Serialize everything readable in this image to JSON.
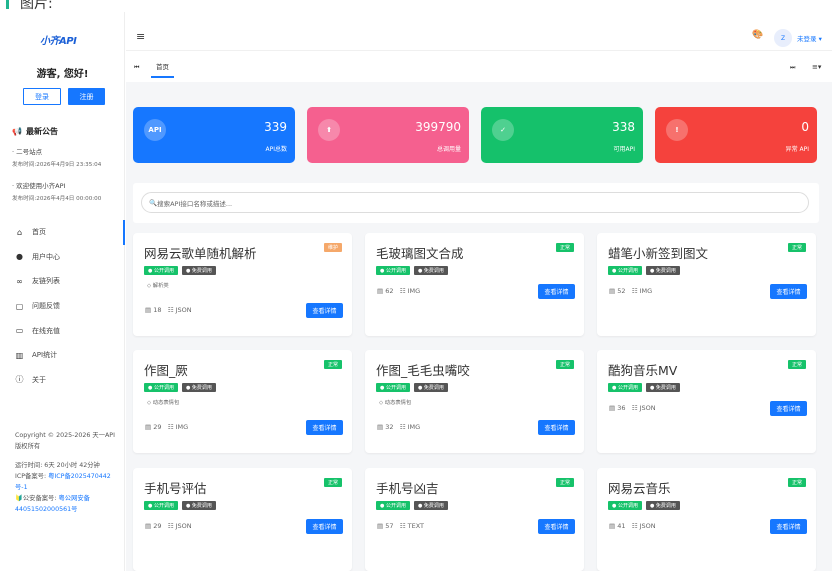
{
  "page": {
    "caption": "图片:"
  },
  "sidebar": {
    "logo_text": "小齐API",
    "greeting": "游客, 您好!",
    "login_label": "登录",
    "register_label": "注册",
    "notice_title": "最新公告",
    "notices": [
      {
        "title": "· 二号站点",
        "date": "发布时间:2026年4月9日 23:35:04"
      },
      {
        "title": "· 欢迎使用小齐API",
        "date": "发布时间:2026年4月4日 00:00:00"
      }
    ],
    "menu": [
      {
        "label": "首页",
        "icon": "home-icon"
      },
      {
        "label": "用户中心",
        "icon": "user-icon"
      },
      {
        "label": "友链列表",
        "icon": "link-icon"
      },
      {
        "label": "问题反馈",
        "icon": "feedback-icon"
      },
      {
        "label": "在线充值",
        "icon": "card-icon"
      },
      {
        "label": "API统计",
        "icon": "chart-icon"
      },
      {
        "label": "关于",
        "icon": "info-icon"
      }
    ],
    "copyright": "Copyright © 2025-2026 天一API 版权所有",
    "runtime": "运行时间: 6天 20小时 42分钟",
    "icp_label": "ICP备案号:",
    "icp_value": "粤ICP备2025470442号-1",
    "police_label": "公安备案号:",
    "police_value": "粤公网安备44051502000561号"
  },
  "header": {
    "user_label": "未登录",
    "avatar_text": "Z"
  },
  "tabs": {
    "home": "首页"
  },
  "stats": [
    {
      "icon_text": "API",
      "value": "339",
      "label": "API总数",
      "color": "#1677ff"
    },
    {
      "icon_text": "⬆",
      "value": "399790",
      "label": "总调用量",
      "color": "#f5608f"
    },
    {
      "icon_text": "✓",
      "value": "338",
      "label": "可用API",
      "color": "#15c16b"
    },
    {
      "icon_text": "!",
      "value": "0",
      "label": "异常 API",
      "color": "#f5423d"
    }
  ],
  "search": {
    "placeholder": "搜索API接口名称或描述..."
  },
  "tag_labels": {
    "public": "公开调用",
    "free": "免费调用"
  },
  "detail_label": "查看详情",
  "cards": [
    {
      "title": "网易云歌单随机解析",
      "badge": "维护",
      "badge_color": "#f5a86a",
      "category": "解析类",
      "count": "18",
      "format": "JSON"
    },
    {
      "title": "毛玻璃图文合成",
      "badge": "正常",
      "badge_color": "#16c26a",
      "category": "",
      "count": "62",
      "format": "IMG"
    },
    {
      "title": "蜡笔小新签到图文",
      "badge": "正常",
      "badge_color": "#16c26a",
      "category": "",
      "count": "52",
      "format": "IMG"
    },
    {
      "title": "作图_厥",
      "badge": "正常",
      "badge_color": "#16c26a",
      "category": "动态表情包",
      "count": "29",
      "format": "IMG"
    },
    {
      "title": "作图_毛毛虫嘴咬",
      "badge": "正常",
      "badge_color": "#16c26a",
      "category": "动态表情包",
      "count": "32",
      "format": "IMG"
    },
    {
      "title": "酷狗音乐MV",
      "badge": "正常",
      "badge_color": "#16c26a",
      "category": "",
      "count": "36",
      "format": "JSON"
    },
    {
      "title": "手机号评估",
      "badge": "正常",
      "badge_color": "#16c26a",
      "category": "",
      "count": "29",
      "format": "JSON"
    },
    {
      "title": "手机号凶吉",
      "badge": "正常",
      "badge_color": "#16c26a",
      "category": "",
      "count": "57",
      "format": "TEXT"
    },
    {
      "title": "网易云音乐",
      "badge": "正常",
      "badge_color": "#16c26a",
      "category": "",
      "count": "41",
      "format": "JSON"
    }
  ]
}
